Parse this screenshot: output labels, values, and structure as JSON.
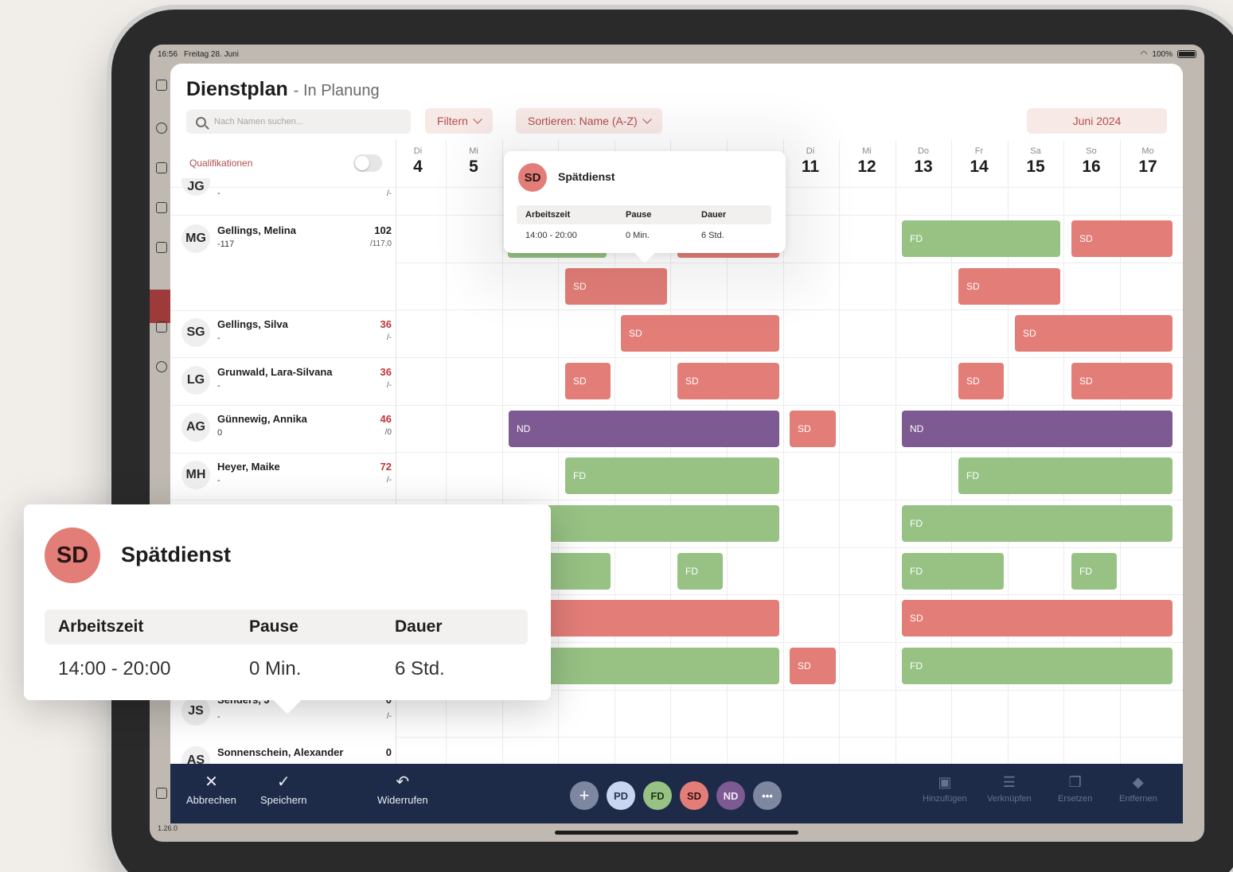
{
  "status": {
    "time": "16:56",
    "date": "Freitag 28. Juni",
    "battery": "100%"
  },
  "header": {
    "title": "Dienstplan",
    "subtitle": "- In Planung"
  },
  "search": {
    "placeholder": "Nach Namen suchen..."
  },
  "filters": {
    "filter_label": "Filtern",
    "sort_label": "Sortieren: Name (A-Z)",
    "month_label": "Juni 2024"
  },
  "qualifications": {
    "label": "Qualifikationen",
    "toggle_on": false
  },
  "days": [
    {
      "name": "Di",
      "num": "4"
    },
    {
      "name": "Mi",
      "num": "5"
    },
    {
      "name": "Di",
      "num": "11"
    },
    {
      "name": "Mi",
      "num": "12"
    },
    {
      "name": "Do",
      "num": "13"
    },
    {
      "name": "Fr",
      "num": "14"
    },
    {
      "name": "Sa",
      "num": "15"
    },
    {
      "name": "So",
      "num": "16"
    },
    {
      "name": "Mo",
      "num": "17"
    }
  ],
  "employees": [
    {
      "initials": "JG",
      "name": "",
      "sub": "-",
      "hours": "",
      "total": "/-"
    },
    {
      "initials": "MG",
      "name": "Gellings, Melina",
      "sub": "-117",
      "hours": "102",
      "total": "/117,0",
      "hours_red": false
    },
    {
      "initials": "SG",
      "name": "Gellings, Silva",
      "sub": "-",
      "hours": "36",
      "total": "/-",
      "hours_red": true
    },
    {
      "initials": "LG",
      "name": "Grunwald, Lara-Silvana",
      "sub": "-",
      "hours": "36",
      "total": "/-",
      "hours_red": true
    },
    {
      "initials": "AG",
      "name": "Günnewig, Annika",
      "sub": "0",
      "hours": "46",
      "total": "/0",
      "hours_red": true
    },
    {
      "initials": "MH",
      "name": "Heyer, Maike",
      "sub": "-",
      "hours": "72",
      "total": "/-",
      "hours_red": true
    },
    {
      "initials": "JS",
      "name": "Senders, J",
      "sub": "-",
      "hours": "0",
      "total": "/-",
      "hours_red": false
    },
    {
      "initials": "AS",
      "name": "Sonnenschein, Alexander",
      "sub": "",
      "hours": "0",
      "total": "",
      "hours_red": false
    }
  ],
  "shift_codes": {
    "sd": "SD",
    "fd": "FD",
    "nd": "ND"
  },
  "popover": {
    "badge": "SD",
    "title": "Spätdienst",
    "col_work": "Arbeitszeit",
    "col_pause": "Pause",
    "col_duration": "Dauer",
    "work": "14:00 - 20:00",
    "pause": "0 Min.",
    "duration": "6 Std."
  },
  "toolbar": {
    "cancel": "Abbrechen",
    "save": "Speichern",
    "undo": "Widerrufen",
    "add": "Hinzufügen",
    "link": "Verknüpfen",
    "replace": "Ersetzen",
    "remove": "Entfernen",
    "shift_buttons": [
      "PD",
      "FD",
      "SD",
      "ND"
    ]
  },
  "colors": {
    "accent": "#b34d4d",
    "sd": "#e37d78",
    "fd": "#97c284",
    "nd": "#7d5a92",
    "toolbar": "#1e2b48",
    "pd": "#c9d6f2"
  },
  "version": "1.26.0"
}
